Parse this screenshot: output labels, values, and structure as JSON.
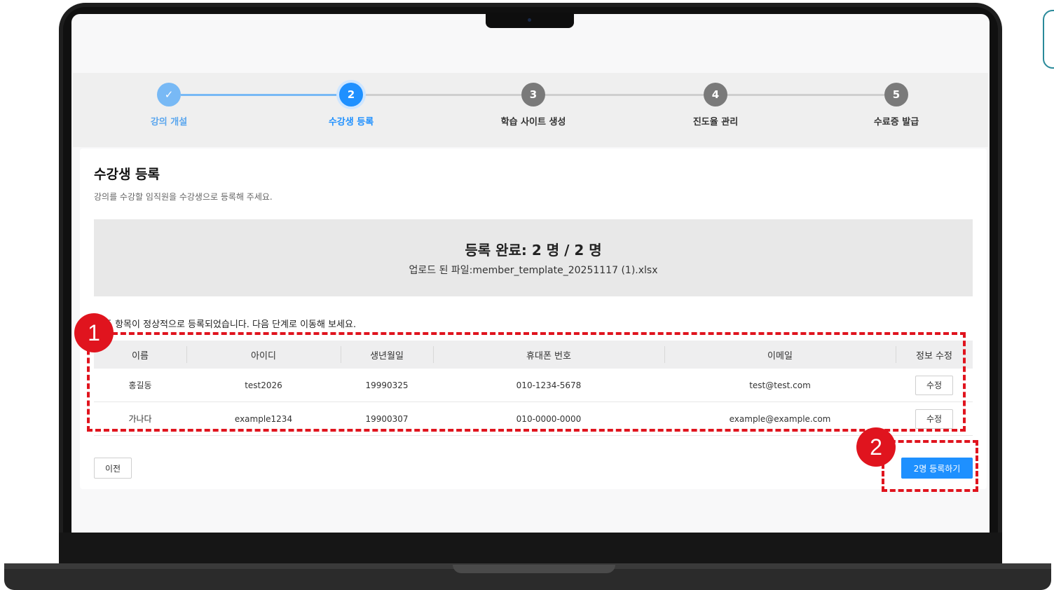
{
  "stepper": {
    "steps": [
      {
        "num": "✓",
        "label": "강의 개설",
        "state": "done"
      },
      {
        "num": "2",
        "label": "수강생 등록",
        "state": "active"
      },
      {
        "num": "3",
        "label": "학습 사이트 생성",
        "state": "pending"
      },
      {
        "num": "4",
        "label": "진도율 관리",
        "state": "pending"
      },
      {
        "num": "5",
        "label": "수료증 발급",
        "state": "pending"
      }
    ]
  },
  "page": {
    "title": "수강생 등록",
    "subtitle": "강의를 수강할 임직원을 수강생으로 등록해 주세요."
  },
  "summary": {
    "title": "등록 완료: 2 명 / 2 명",
    "file": "업로드 된 파일:member_template_20251117 (1).xlsx"
  },
  "notice": "든 항목이 정상적으로 등록되었습니다. 다음 단계로 이동해 보세요.",
  "table": {
    "headers": [
      "이름",
      "아이디",
      "생년월일",
      "휴대폰 번호",
      "이메일",
      "정보 수정"
    ],
    "rows": [
      [
        "홍길동",
        "test2026",
        "19990325",
        "010-1234-5678",
        "test@test.com",
        "수정"
      ],
      [
        "가나다",
        "example1234",
        "19900307",
        "010-0000-0000",
        "example@example.com",
        "수정"
      ]
    ]
  },
  "buttons": {
    "prev": "이전",
    "register": "2명 등록하기"
  },
  "annotations": {
    "badge1": "1",
    "badge2": "2"
  },
  "colors": {
    "accent": "#1e90ff",
    "done": "#78b9f5",
    "pending": "#7a7a7a",
    "annotation": "#e0141e"
  }
}
